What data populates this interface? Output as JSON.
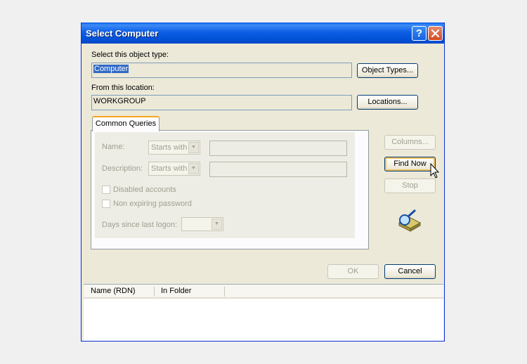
{
  "dialog": {
    "title": "Select Computer",
    "help_icon": "?",
    "object_type_label": "Select this object type:",
    "object_type_value": "Computer",
    "object_types_button": "Object Types...",
    "location_label": "From this location:",
    "location_value": "WORKGROUP",
    "locations_button": "Locations...",
    "tab_label": "Common Queries",
    "name_label": "Name:",
    "name_mode": "Starts with",
    "description_label": "Description:",
    "description_mode": "Starts with",
    "disabled_accounts": "Disabled accounts",
    "non_expiring_password": "Non expiring password",
    "days_since_logon": "Days since last logon:",
    "columns_button": "Columns...",
    "find_now_button": "Find Now",
    "stop_button": "Stop",
    "ok_button": "OK",
    "cancel_button": "Cancel",
    "results_columns": [
      "Name (RDN)",
      "In Folder"
    ]
  },
  "colors": {
    "titlebar": "#0a5ee8",
    "face": "#ece9d8",
    "focus": "#f2c260"
  }
}
